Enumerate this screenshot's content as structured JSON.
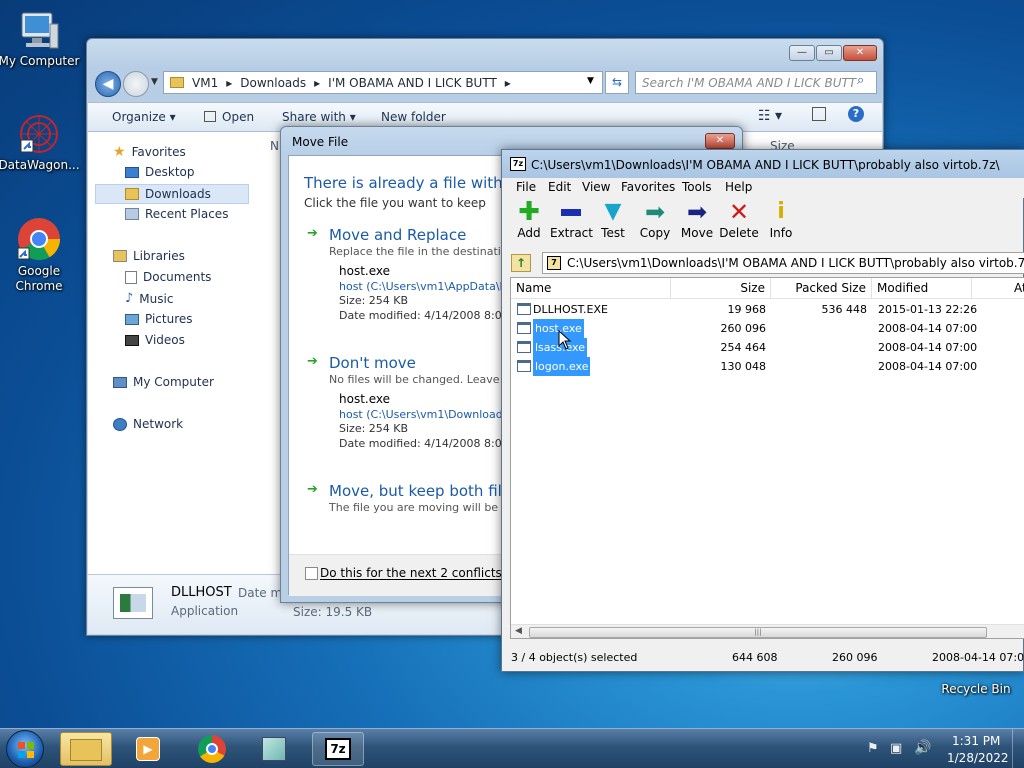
{
  "desktop": {
    "icons": [
      {
        "label": "My Computer"
      },
      {
        "label": "DataWagon..."
      },
      {
        "label": "Google Chrome"
      },
      {
        "label": "Recycle Bin"
      }
    ]
  },
  "explorer": {
    "breadcrumb": [
      "VM1",
      "Downloads",
      "I'M OBAMA AND I LICK BUTT"
    ],
    "search_placeholder": "Search I'M OBAMA AND I LICK BUTT",
    "toolbar": {
      "organize": "Organize",
      "open": "Open",
      "share_with": "Share with",
      "new_folder": "New folder"
    },
    "column_partial_n": "N",
    "column_partial_size": "Size",
    "nav": {
      "favorites": "Favorites",
      "desktop": "Desktop",
      "downloads": "Downloads",
      "recent": "Recent Places",
      "libraries": "Libraries",
      "documents": "Documents",
      "music": "Music",
      "pictures": "Pictures",
      "videos": "Videos",
      "my_computer": "My Computer",
      "network": "Network"
    },
    "details": {
      "name": "DLLHOST",
      "type": "Application",
      "date_label": "Date mo",
      "size": "Size: 19.5 KB"
    }
  },
  "move_dialog": {
    "title": "Move File",
    "heading": "There is already a file with th",
    "subheading": "Click the file you want to keep",
    "options": [
      {
        "title": "Move and Replace",
        "desc": "Replace the file in the destination",
        "file": "host.exe",
        "path": "host (C:\\Users\\vm1\\AppData\\L",
        "size": "Size: 254 KB",
        "date": "Date modified: 4/14/2008 8:00 A"
      },
      {
        "title": "Don't move",
        "desc": "No files will be changed. Leave th",
        "file": "host.exe",
        "path": "host (C:\\Users\\vm1\\Downloads",
        "size": "Size: 254 KB",
        "date": "Date modified: 4/14/2008 8:00 A"
      },
      {
        "title": "Move, but keep both files",
        "desc": "The file you are moving will be re"
      }
    ],
    "checkbox_label": "Do this for the next 2 conflicts"
  },
  "sevenzip": {
    "title": "C:\\Users\\vm1\\Downloads\\I'M OBAMA AND I LICK BUTT\\probably also virtob.7z\\",
    "menu": [
      "File",
      "Edit",
      "View",
      "Favorites",
      "Tools",
      "Help"
    ],
    "tools": [
      {
        "label": "Add",
        "icon": "plus-icon",
        "color": "#22aa22"
      },
      {
        "label": "Extract",
        "icon": "minus-icon",
        "color": "#1a2fb0"
      },
      {
        "label": "Test",
        "icon": "check-icon",
        "color": "#19a5c9"
      },
      {
        "label": "Copy",
        "icon": "copy-arrow-icon",
        "color": "#1f8a7a"
      },
      {
        "label": "Move",
        "icon": "move-arrow-icon",
        "color": "#1a237e"
      },
      {
        "label": "Delete",
        "icon": "delete-x-icon",
        "color": "#d01818"
      },
      {
        "label": "Info",
        "icon": "info-icon",
        "color": "#d4b000"
      }
    ],
    "address": "C:\\Users\\vm1\\Downloads\\I'M OBAMA AND I LICK BUTT\\probably also virtob.7z\\",
    "columns": {
      "name": "Name",
      "size": "Size",
      "packed": "Packed Size",
      "modified": "Modified",
      "attr": "At"
    },
    "files": [
      {
        "name": "DLLHOST.EXE",
        "size": "19 968",
        "packed": "536 448",
        "modified": "2015-01-13 22:26",
        "selected": false
      },
      {
        "name": "host.exe",
        "size": "260 096",
        "packed": "",
        "modified": "2008-04-14 07:00",
        "selected": true
      },
      {
        "name": "lsass.exe",
        "size": "254 464",
        "packed": "",
        "modified": "2008-04-14 07:00",
        "selected": true
      },
      {
        "name": "logon.exe",
        "size": "130 048",
        "packed": "",
        "modified": "2008-04-14 07:00",
        "selected": true
      }
    ],
    "status": {
      "selected": "3 / 4 object(s) selected",
      "size": "644 608",
      "packed": "260 096",
      "modified": "2008-04-14 07:00"
    }
  },
  "taskbar": {
    "time": "1:31 PM",
    "date": "1/28/2022"
  }
}
